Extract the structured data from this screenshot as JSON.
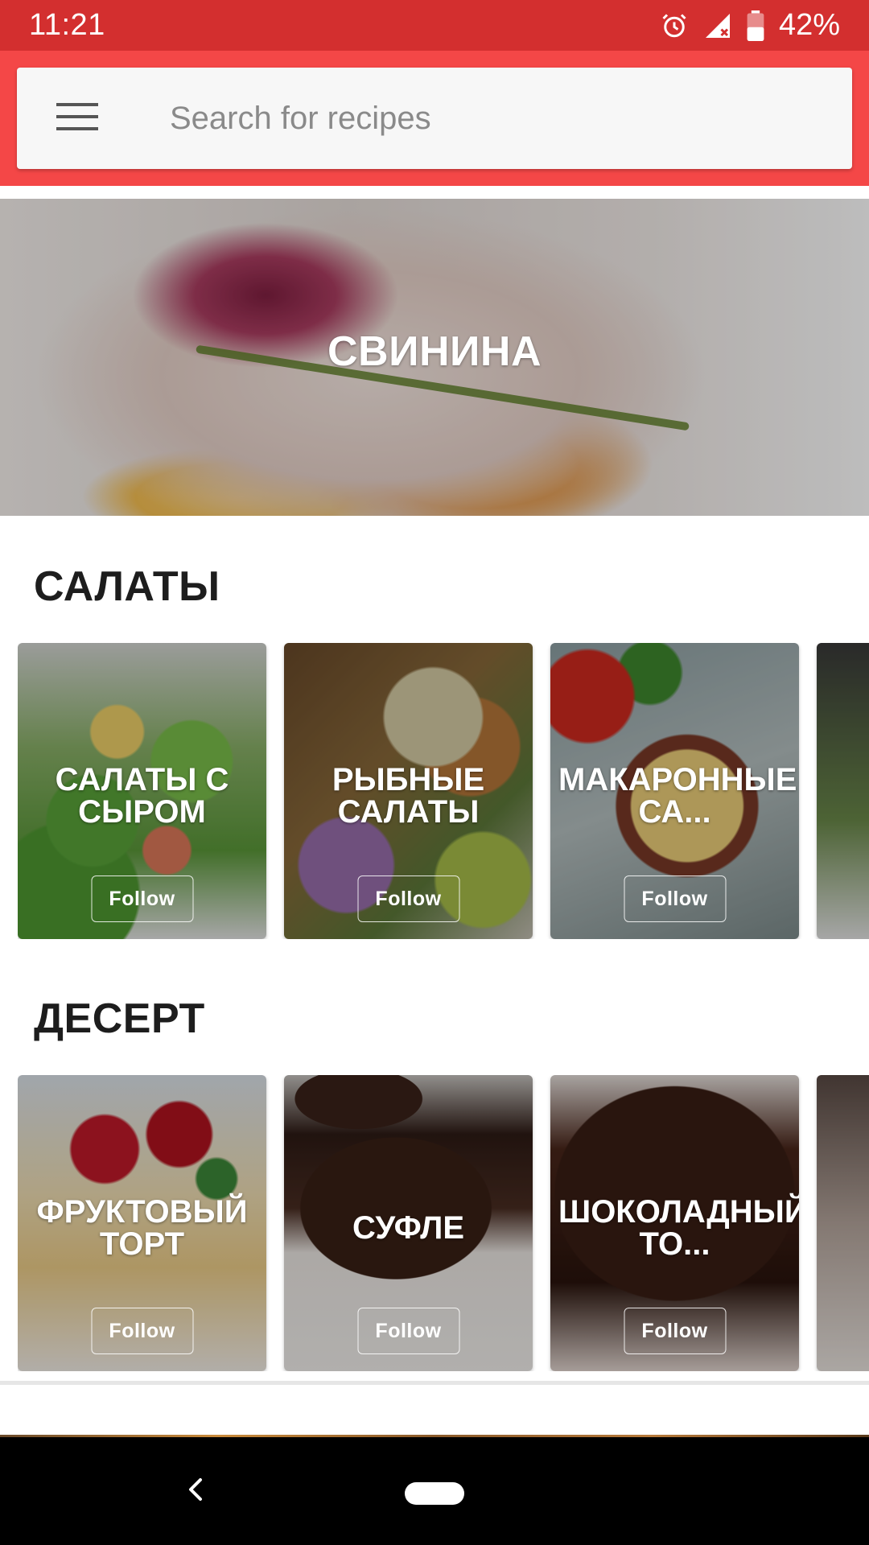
{
  "status_bar": {
    "time": "11:21",
    "battery": "42%",
    "icons": [
      "alarm-icon",
      "cellular-no-signal-icon",
      "battery-icon"
    ]
  },
  "search": {
    "placeholder": "Search for recipes",
    "menu_icon": "hamburger-menu-icon"
  },
  "hero": {
    "title": "СВИНИНА"
  },
  "sections": [
    {
      "title": "САЛАТЫ",
      "cards": [
        {
          "title": "САЛАТЫ С СЫРОМ",
          "follow": "Follow"
        },
        {
          "title": "РЫБНЫЕ САЛАТЫ",
          "follow": "Follow"
        },
        {
          "title": "МАКАРОННЫЕ СА...",
          "follow": "Follow"
        },
        {
          "title": "",
          "follow": ""
        }
      ]
    },
    {
      "title": "ДЕСЕРТ",
      "cards": [
        {
          "title": "ФРУКТОВЫЙ ТОРТ",
          "follow": "Follow"
        },
        {
          "title": "СУФЛЕ",
          "follow": "Follow"
        },
        {
          "title": "ШОКОЛАДНЫЙ ТО...",
          "follow": "Follow"
        },
        {
          "title": "",
          "follow": ""
        }
      ]
    }
  ],
  "nav_bar": {
    "icons": [
      "back-icon",
      "home-pill-icon"
    ]
  },
  "colors": {
    "status_bar": "#d32f2f",
    "app_bar": "#f44747",
    "search_bg": "#f7f7f7"
  }
}
